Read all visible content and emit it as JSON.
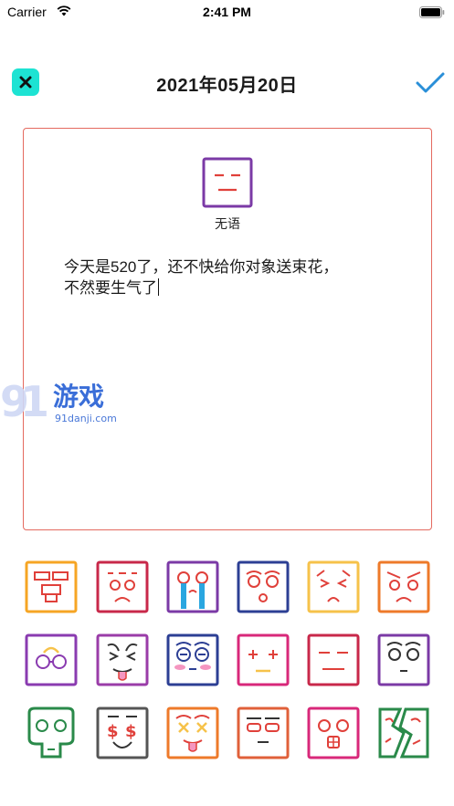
{
  "status_bar": {
    "carrier": "Carrier",
    "time": "2:41 PM"
  },
  "nav": {
    "title": "2021年05月20日",
    "close_icon": "close-icon",
    "confirm_icon": "checkmark-icon"
  },
  "mood": {
    "label": "无语"
  },
  "diary": {
    "line1": "今天是520了，还不快给你对象送束花，",
    "line2": "不然要生气了"
  },
  "watermark": {
    "brand": "游戏",
    "url": "91danji.com"
  },
  "colors": {
    "accent": "#1de3d3",
    "confirm": "#2a8fd8",
    "card_border": "#e46a5f"
  },
  "emoji_icons": [
    "robot-face-icon",
    "grumpy-face-icon",
    "crying-face-icon",
    "surprised-face-icon",
    "sad-face-icon",
    "angry-face-icon",
    "glasses-face-icon",
    "tongue-face-icon",
    "blushing-face-icon",
    "plus-eyes-face-icon",
    "speechless-face-icon",
    "neutral-face-icon",
    "skull-face-icon",
    "money-face-icon",
    "dizzy-face-icon",
    "sleepy-face-icon",
    "shocked-face-icon",
    "cracked-face-icon"
  ]
}
